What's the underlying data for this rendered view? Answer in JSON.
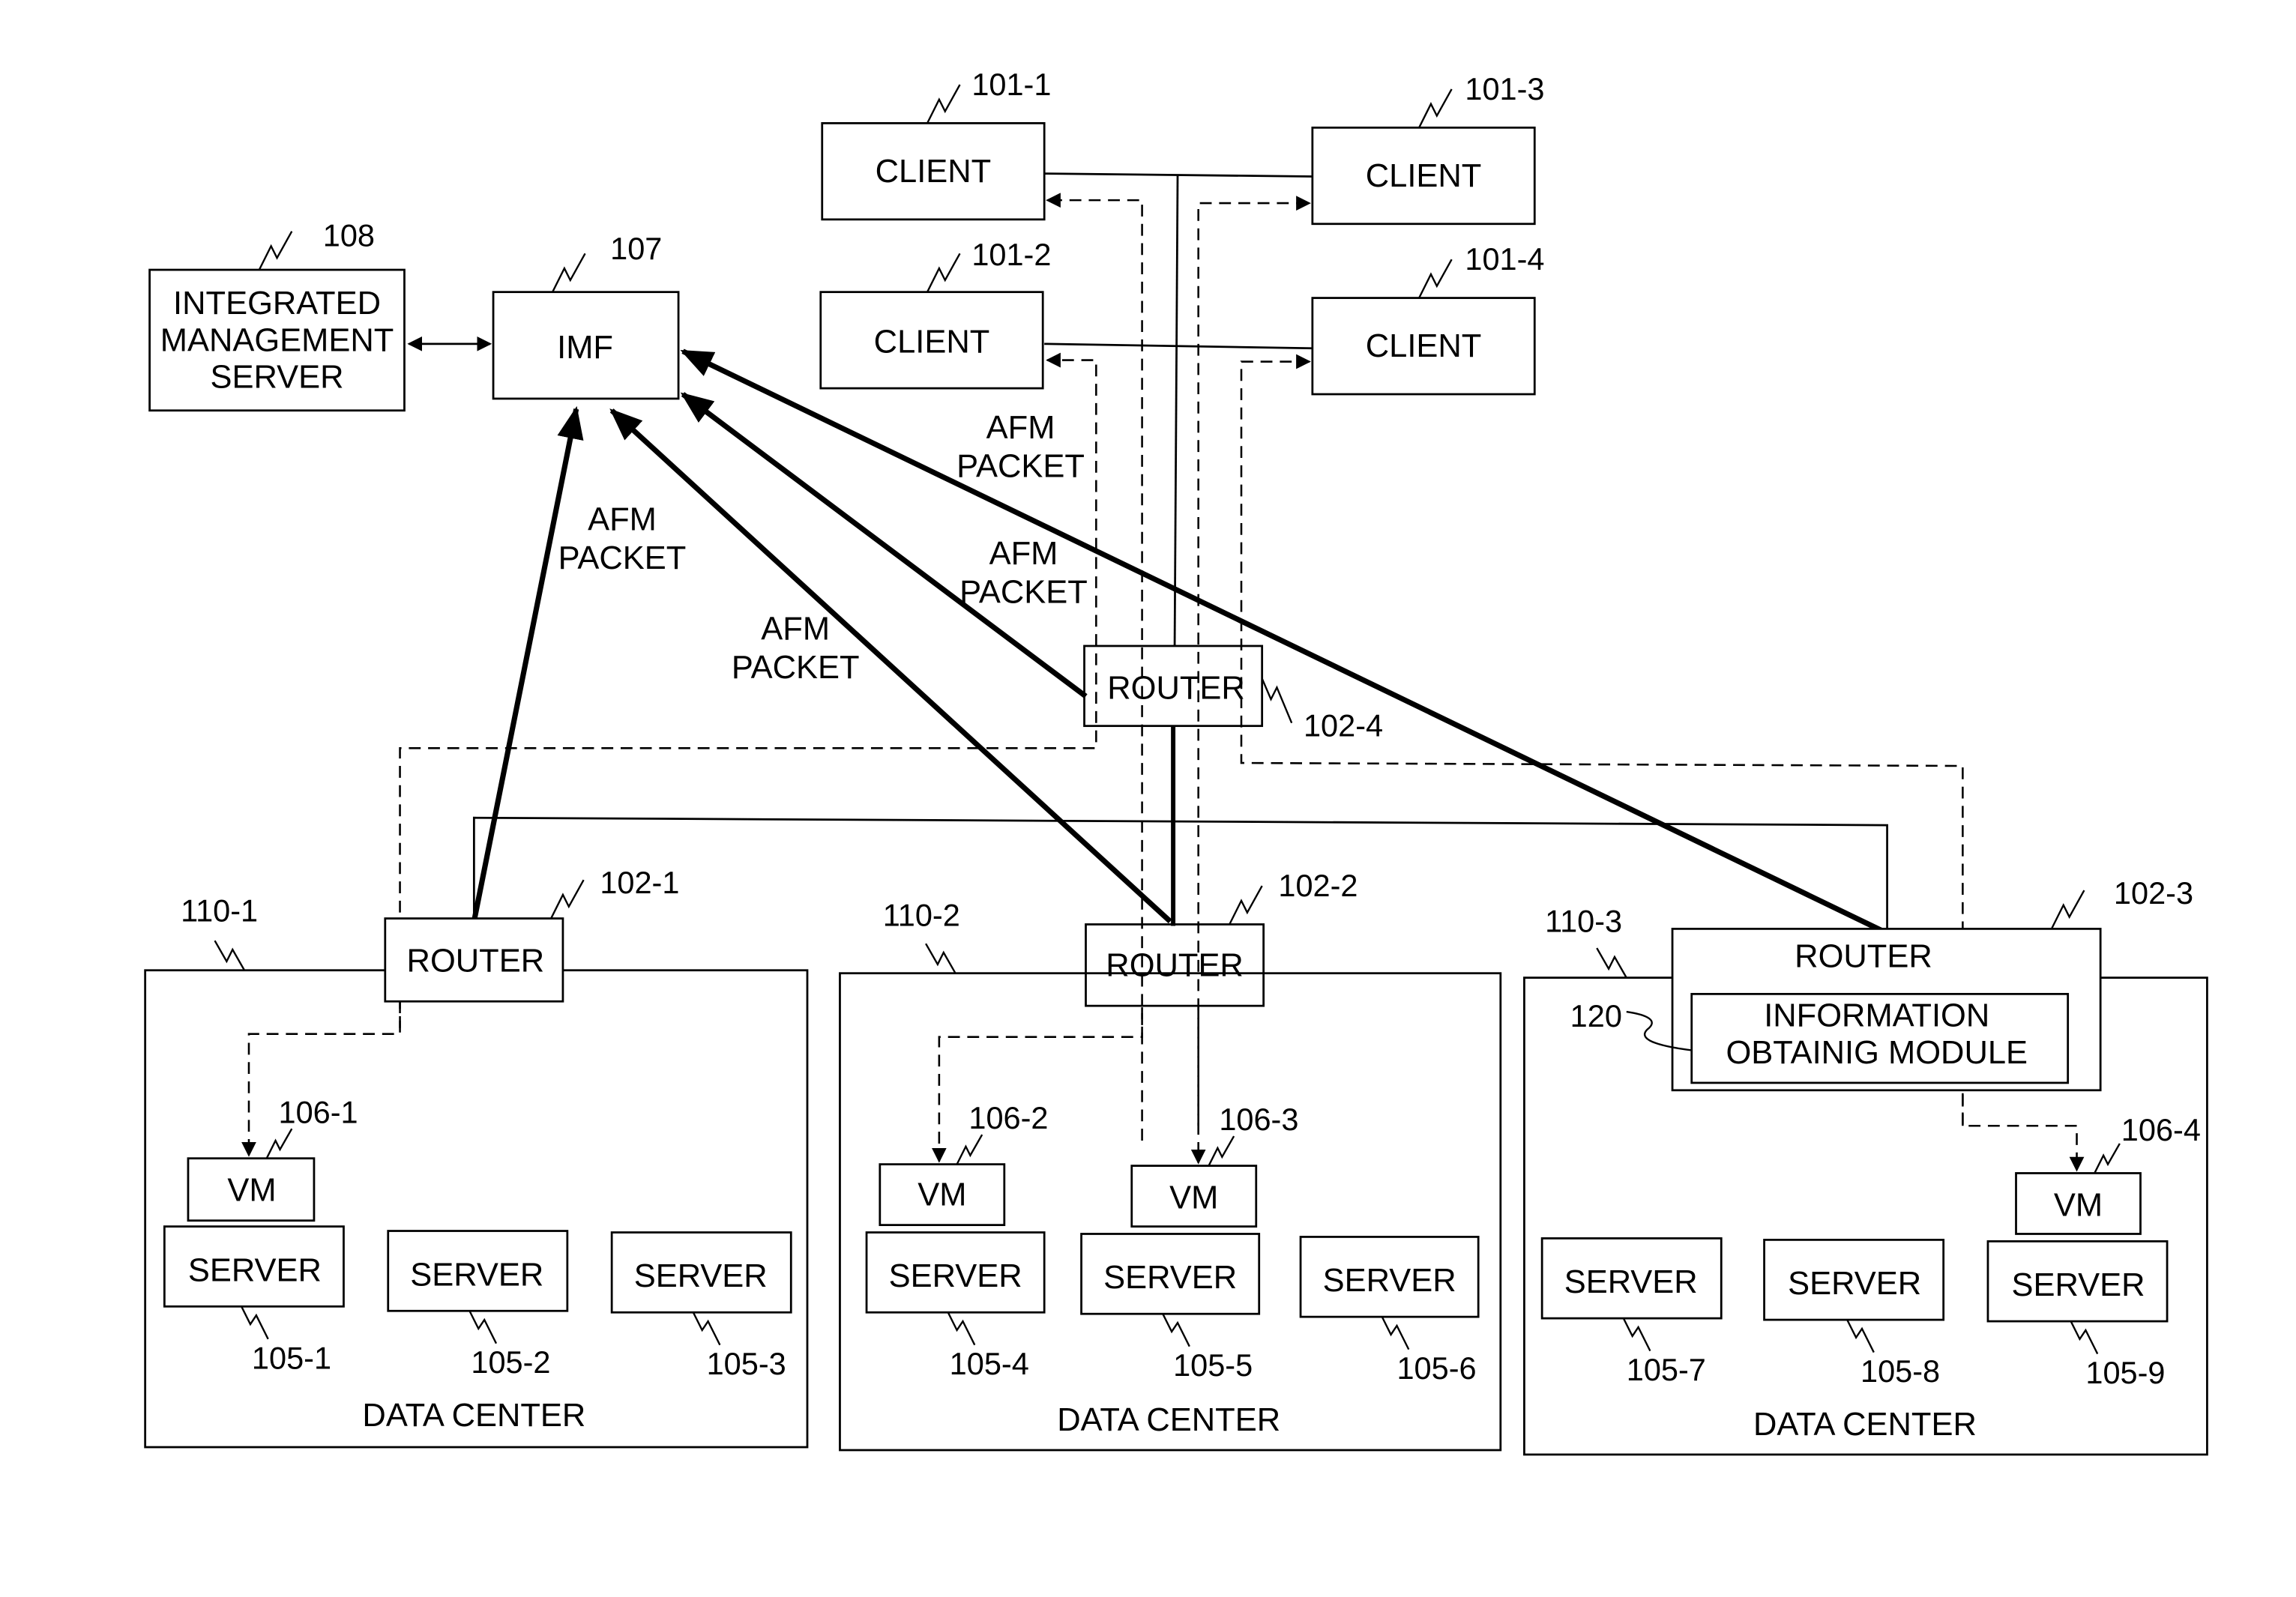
{
  "diagram": {
    "clients": [
      {
        "ref": "101-1",
        "label": "CLIENT"
      },
      {
        "ref": "101-2",
        "label": "CLIENT"
      },
      {
        "ref": "101-3",
        "label": "CLIENT"
      },
      {
        "ref": "101-4",
        "label": "CLIENT"
      }
    ],
    "integrated_management_server": {
      "ref": "108",
      "lines": [
        "INTEGRATED",
        "MANAGEMENT",
        "SERVER"
      ]
    },
    "imf": {
      "ref": "107",
      "label": "IMF"
    },
    "afm_packet_labels": [
      {
        "line1": "AFM",
        "line2": "PACKET"
      },
      {
        "line1": "AFM",
        "line2": "PACKET"
      },
      {
        "line1": "AFM",
        "line2": "PACKET"
      },
      {
        "line1": "AFM",
        "line2": "PACKET"
      }
    ],
    "routers": [
      {
        "ref": "102-1",
        "label": "ROUTER"
      },
      {
        "ref": "102-2",
        "label": "ROUTER"
      },
      {
        "ref": "102-3",
        "label": "ROUTER"
      },
      {
        "ref": "102-4",
        "label": "ROUTER"
      }
    ],
    "information_module": {
      "ref": "120",
      "line1": "INFORMATION",
      "line2": "OBTAINIG MODULE"
    },
    "data_centers": [
      {
        "ref": "110-1",
        "label": "DATA CENTER",
        "vms": [
          {
            "ref": "106-1",
            "label": "VM"
          }
        ],
        "servers": [
          {
            "ref": "105-1",
            "label": "SERVER"
          },
          {
            "ref": "105-2",
            "label": "SERVER"
          },
          {
            "ref": "105-3",
            "label": "SERVER"
          }
        ]
      },
      {
        "ref": "110-2",
        "label": "DATA CENTER",
        "vms": [
          {
            "ref": "106-2",
            "label": "VM"
          },
          {
            "ref": "106-3",
            "label": "VM"
          }
        ],
        "servers": [
          {
            "ref": "105-4",
            "label": "SERVER"
          },
          {
            "ref": "105-5",
            "label": "SERVER"
          },
          {
            "ref": "105-6",
            "label": "SERVER"
          }
        ]
      },
      {
        "ref": "110-3",
        "label": "DATA CENTER",
        "vms": [
          {
            "ref": "106-4",
            "label": "VM"
          }
        ],
        "servers": [
          {
            "ref": "105-7",
            "label": "SERVER"
          },
          {
            "ref": "105-8",
            "label": "SERVER"
          },
          {
            "ref": "105-9",
            "label": "SERVER"
          }
        ]
      }
    ]
  }
}
